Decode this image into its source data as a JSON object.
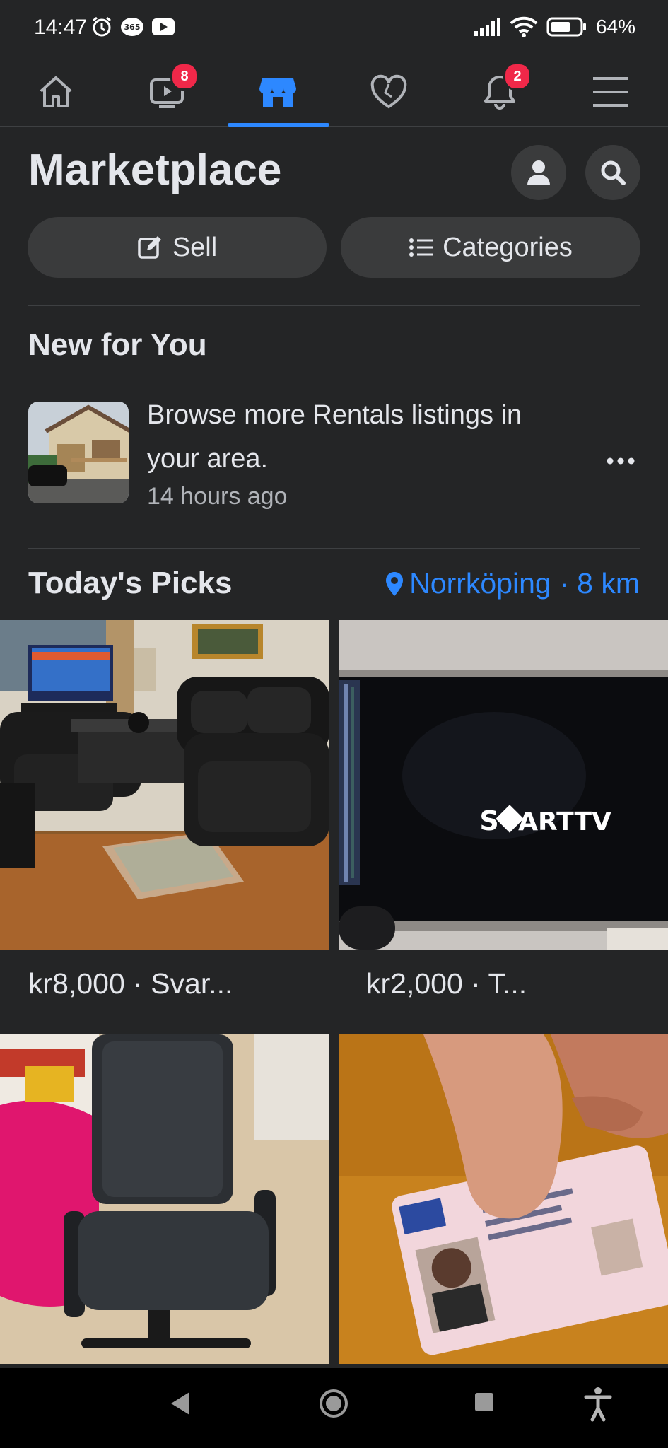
{
  "status_bar": {
    "time": "14:47",
    "battery_text": "64%",
    "icons": [
      "alarm-icon",
      "365-icon",
      "youtube-icon",
      "signal-icon",
      "wifi-icon",
      "battery-icon"
    ]
  },
  "nav": {
    "items": [
      {
        "name": "home",
        "icon": "home-icon",
        "badge": ""
      },
      {
        "name": "watch",
        "icon": "video-icon",
        "badge": "8"
      },
      {
        "name": "marketplace",
        "icon": "shop-icon",
        "badge": "",
        "active": true
      },
      {
        "name": "dating",
        "icon": "heart-icon",
        "badge": ""
      },
      {
        "name": "notifications",
        "icon": "bell-icon",
        "badge": "2"
      },
      {
        "name": "menu",
        "icon": "hamburger-icon",
        "badge": ""
      }
    ],
    "accent": "#2d88ff"
  },
  "header": {
    "title": "Marketplace"
  },
  "actions": {
    "sell_label": "Sell",
    "categories_label": "Categories"
  },
  "new_for_you": {
    "title": "New for You",
    "item": {
      "text": "Browse more Rentals listings in your area.",
      "time": "14 hours ago"
    }
  },
  "todays_picks": {
    "title": "Today's Picks",
    "location": "Norrköping · 8 km",
    "listings": [
      {
        "price_label": "kr8,000 · Svar...",
        "image": "living room with black leather sofas"
      },
      {
        "price_label": "kr2,000 · T...",
        "image": "smart tv screen"
      },
      {
        "price_label": "",
        "image": "black office chair"
      },
      {
        "price_label": "",
        "image": "driving license card"
      }
    ]
  },
  "colors": {
    "background": "#242526",
    "surface": "#3a3b3c",
    "text": "#e4e6eb",
    "secondary_text": "#b0b3b8",
    "badge": "#f02849"
  }
}
